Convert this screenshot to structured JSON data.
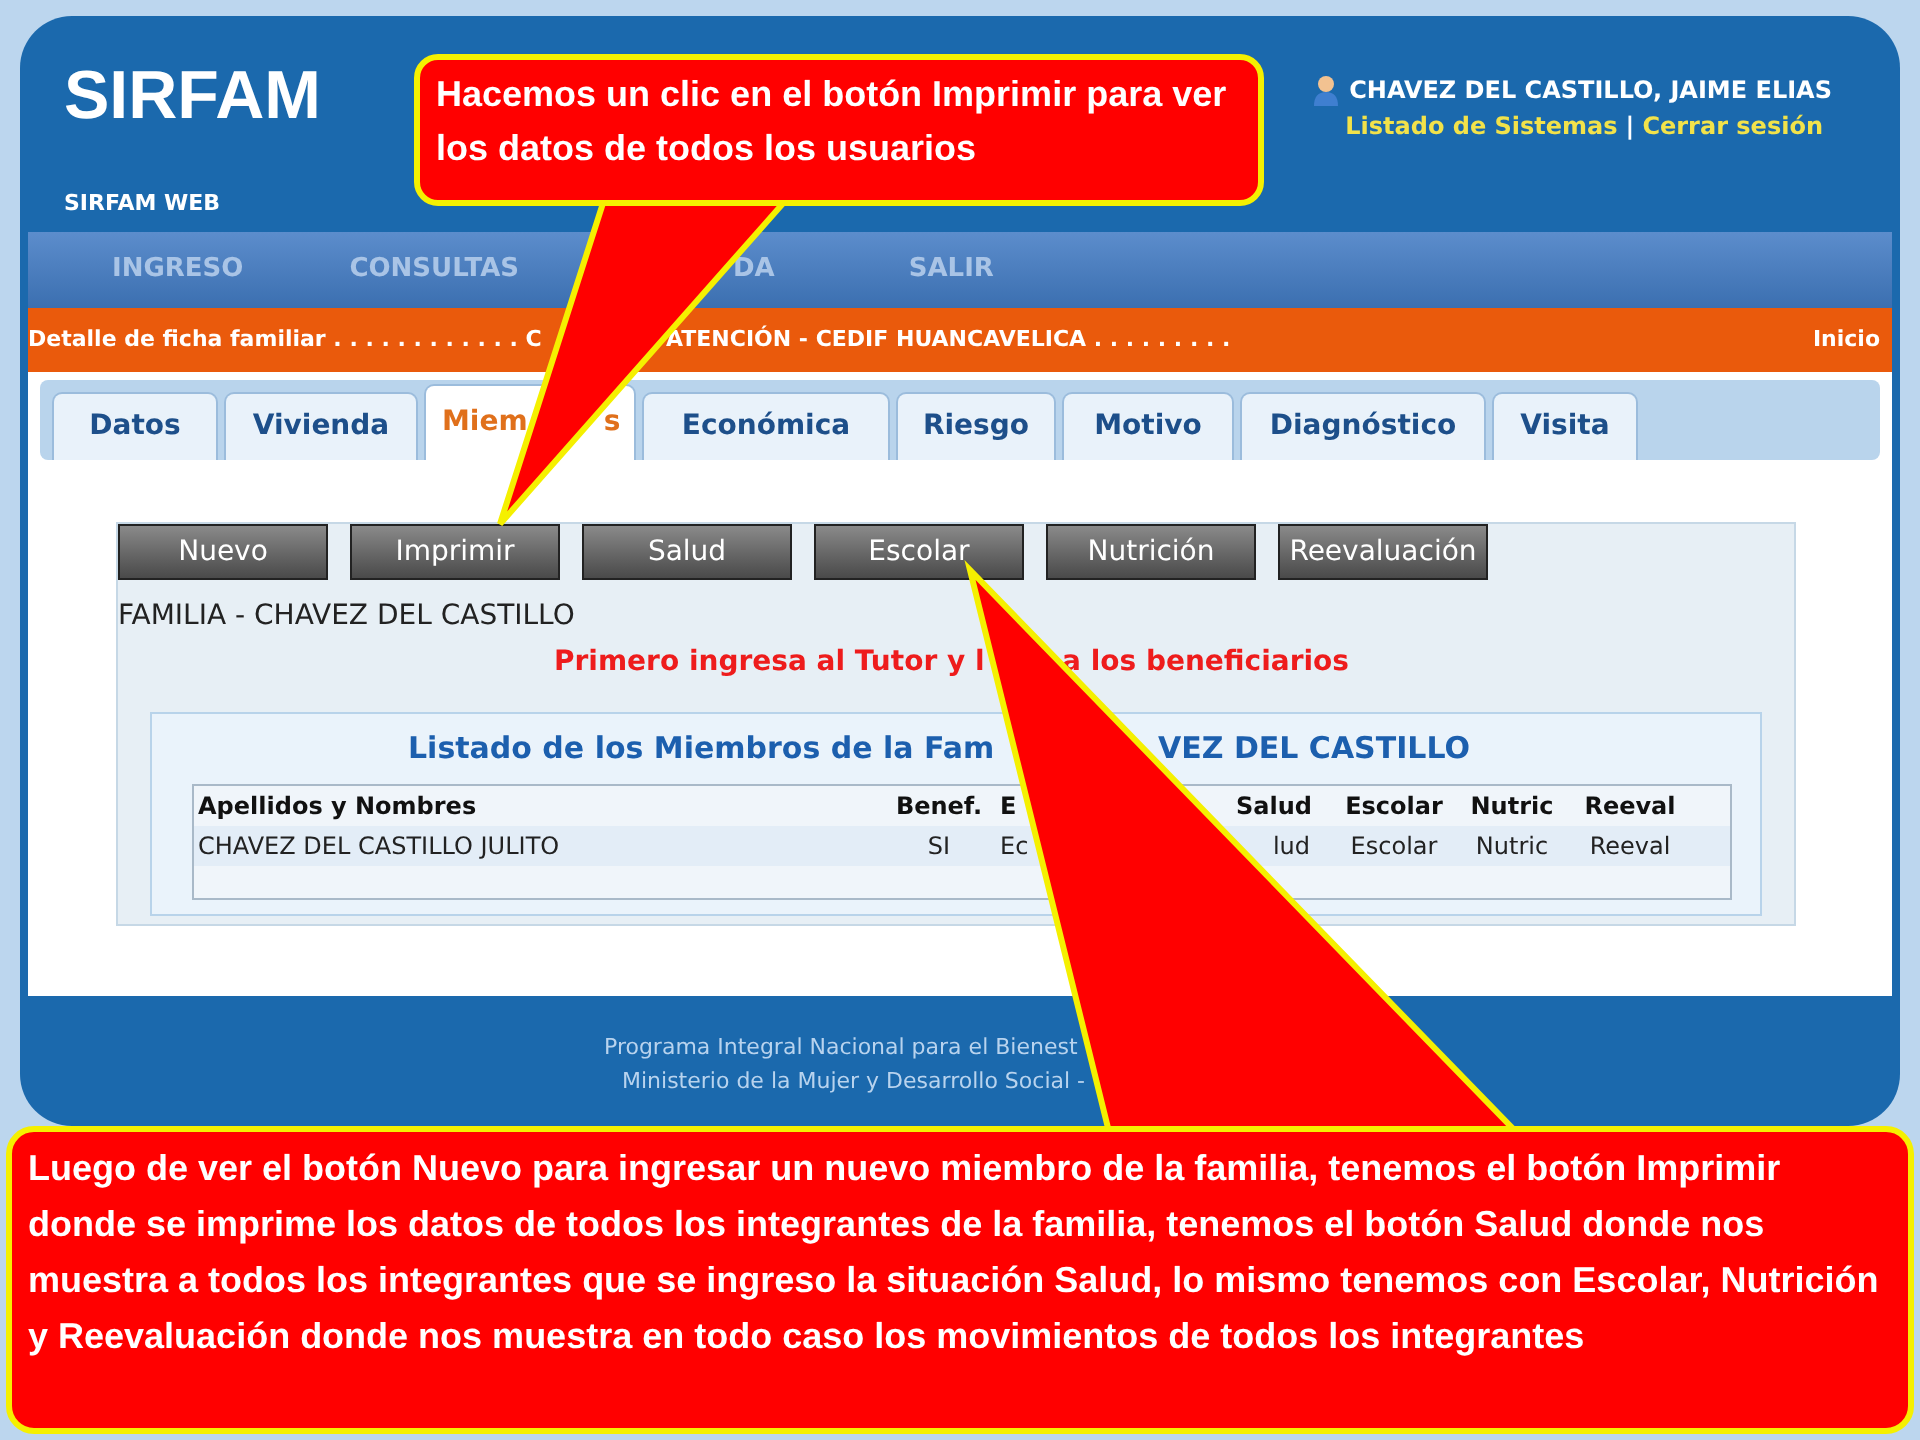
{
  "header": {
    "logo": "SIRFAM",
    "subtitle": "SIRFAM WEB",
    "user": "CHAVEZ DEL CASTILLO, JAIME ELIAS",
    "links": [
      "Listado de Sistemas",
      "Cerrar sesión"
    ],
    "separator": "|"
  },
  "menu": [
    "INGRESO",
    "CONSULTAS",
    "DA",
    "SALIR"
  ],
  "breadcrumb": {
    "parts": [
      "Detalle de ficha familiar . . . . . . . . . . . . C",
      "ATENCIÓN - CEDIF HUANCAVELICA . . . . . . . . ."
    ],
    "home": "Inicio"
  },
  "tabs": [
    {
      "label": "Datos",
      "selected": false
    },
    {
      "label": "Vivienda",
      "selected": false
    },
    {
      "label": "Miem",
      "label_tail": "s",
      "selected": true
    },
    {
      "label": "Económica",
      "selected": false
    },
    {
      "label": "Riesgo",
      "selected": false
    },
    {
      "label": "Motivo",
      "selected": false
    },
    {
      "label": "Diagnóstico",
      "selected": false
    },
    {
      "label": "Visita",
      "selected": false
    }
  ],
  "buttons": [
    "Nuevo",
    "Imprimir",
    "Salud",
    "Escolar",
    "Nutrición",
    "Reevaluación"
  ],
  "family": "FAMILIA - CHAVEZ DEL CASTILLO",
  "notice": [
    "Primero ingresa al Tutor y l",
    "a los beneficiarios"
  ],
  "listing": {
    "title": [
      "Listado de los Miembros de la Fam",
      "VEZ DEL CASTILLO"
    ],
    "columns": [
      "Apellidos y Nombres",
      "Benef.",
      "E",
      "Salud",
      "Escolar",
      "Nutric",
      "Reeval"
    ],
    "rows": [
      [
        "CHAVEZ DEL CASTILLO JULITO",
        "SI",
        "Ec",
        "lud",
        "Escolar",
        "Nutric",
        "Reeval"
      ]
    ]
  },
  "footer": [
    "Programa Integral Nacional para el Bienest",
    "Ministerio de la Mujer y Desarrollo Social -"
  ],
  "callouts": [
    {
      "text": "Hacemos un clic en el botón Imprimir para ver los datos de todos los usuarios"
    },
    {
      "text": "Luego de ver el botón Nuevo para ingresar un nuevo miembro de la familia, tenemos el botón Imprimir  donde se imprime los datos de todos los integrantes de la familia, tenemos el botón Salud donde nos muestra a todos los integrantes que se ingreso la situación Salud, lo mismo tenemos con Escolar, Nutrición y Reevaluación donde nos muestra en todo caso los movimientos de todos los integrantes"
    }
  ]
}
